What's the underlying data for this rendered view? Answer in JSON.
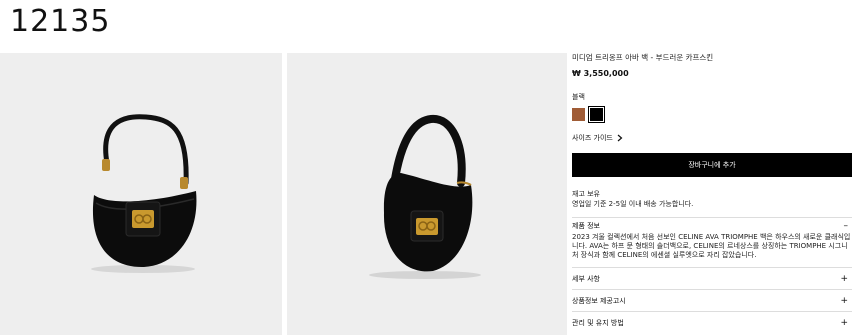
{
  "page": {
    "id_number": "12135"
  },
  "product": {
    "title": "미디엄 트리옹프 아바 백 - 부드러운 카프스킨",
    "price": "₩ 3,550,000",
    "color_label": "블랙",
    "swatches": [
      {
        "name": "brown",
        "color": "#a05c36"
      },
      {
        "name": "black",
        "color": "#000000",
        "selected": true
      }
    ],
    "size_guide": "사이즈 가이드",
    "cart_button": "장바구니에 추가",
    "stock_line1": "재고 보유",
    "stock_line2": "영업일 기준 2-5일 이내 배송 가능합니다."
  },
  "info": {
    "header": "제품 정보",
    "description": "2023 겨울 컬렉션에서 처음 선보인 CELINE AVA TRIOMPHE 백은 하우스의 새로운 클래식입니다. AVA는 하프 문 형태의 숄더백으로, CELINE의 르네상스를 상징하는 TRIOMPHE 시그니처 장식과 함께 CELINE의 에센셜 실루엣으로 자리 잡았습니다."
  },
  "accordion": [
    {
      "label": "세부 사항"
    },
    {
      "label": "상품정보 제공고시"
    },
    {
      "label": "관리 및 유지 방법"
    }
  ],
  "icons": {
    "chevron": "chevron-right-icon",
    "minus": "minus-icon",
    "plus": "plus-icon"
  }
}
